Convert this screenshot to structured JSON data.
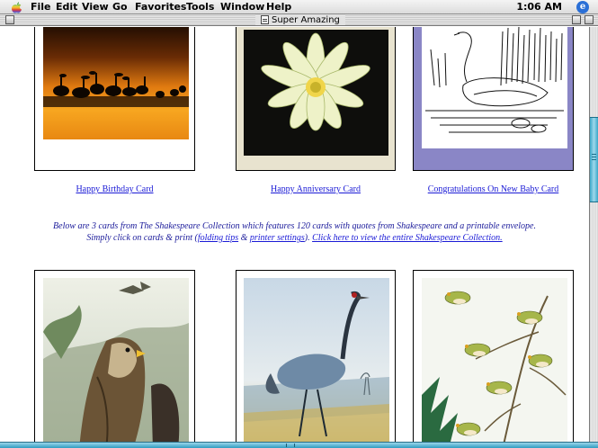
{
  "menubar": {
    "items": [
      "File",
      "Edit",
      "View",
      "Go",
      "Favorites",
      "Tools",
      "Window",
      "Help"
    ],
    "clock": "1:06 AM",
    "app_icon": "e"
  },
  "window": {
    "title": "Super Amazing"
  },
  "top_cards": [
    {
      "caption": "Happy Birthday Card"
    },
    {
      "caption": "Happy Anniversary Card"
    },
    {
      "caption": "Congratulations On New Baby Card"
    }
  ],
  "info": {
    "line1": "Below are 3 cards from The Shakespeare Collection which features 120 cards with quotes from Shakespeare and a printable envelope.",
    "line2_prefix": "Simply click on cards & print (",
    "folding_tips": "folding tips",
    "amp": " & ",
    "printer_settings": "printer settings",
    "line2_mid": ").  ",
    "collection_link": "Click here to view the entire Shakespeare Collection."
  },
  "colors": {
    "link": "#1a1ad6",
    "info_text": "#1a1a9a",
    "scroll_accent": "#3aa6c8"
  }
}
